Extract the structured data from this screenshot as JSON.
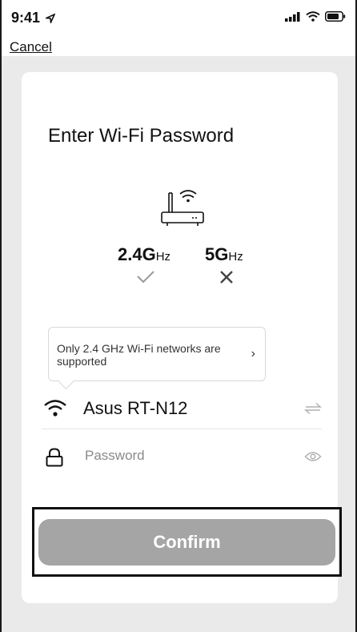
{
  "status_bar": {
    "time": "9:41"
  },
  "nav": {
    "cancel_label": "Cancel"
  },
  "card": {
    "title": "Enter Wi-Fi Password",
    "bands": [
      {
        "main": "2.4",
        "unit_big": "G",
        "unit_small": "Hz",
        "status": "supported"
      },
      {
        "main": "5",
        "unit_big": "G",
        "unit_small": "Hz",
        "status": "unsupported"
      }
    ],
    "notice": {
      "text": "Only 2.4 GHz Wi-Fi networks are supported"
    },
    "network": {
      "ssid": "Asus RT-N12"
    },
    "password": {
      "placeholder": "Password",
      "value": ""
    },
    "confirm_label": "Confirm"
  },
  "colors": {
    "confirm_bg": "#a5a5a5",
    "page_bg": "#eaeaea",
    "card_bg": "#ffffff"
  }
}
